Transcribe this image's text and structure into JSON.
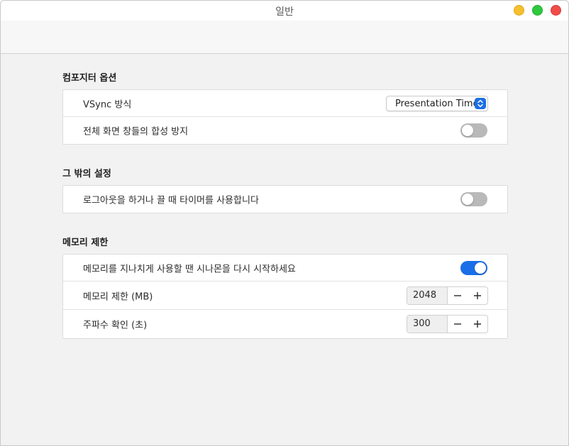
{
  "window": {
    "title": "일반"
  },
  "sections": [
    {
      "title": "컴포지터 옵션",
      "rows": [
        {
          "label": "VSync 방식",
          "control": "select",
          "value": "Presentation Time"
        },
        {
          "label": "전체 화면 창들의 합성 방지",
          "control": "toggle",
          "on": false
        }
      ]
    },
    {
      "title": "그 밖의 설정",
      "rows": [
        {
          "label": "로그아웃을 하거나 끌 때 타이머를 사용합니다",
          "control": "toggle",
          "on": false
        }
      ]
    },
    {
      "title": "메모리 제한",
      "rows": [
        {
          "label": "메모리를 지나치게 사용할 땐 시나몬을 다시 시작하세요",
          "control": "toggle",
          "on": true
        },
        {
          "label": "메모리 제한 (MB)",
          "control": "stepper",
          "value": "2048"
        },
        {
          "label": "주파수 확인 (초)",
          "control": "stepper",
          "value": "300"
        }
      ]
    }
  ],
  "colors": {
    "accent": "#1a6ee8",
    "toggle_off": "#b9b9b9"
  }
}
